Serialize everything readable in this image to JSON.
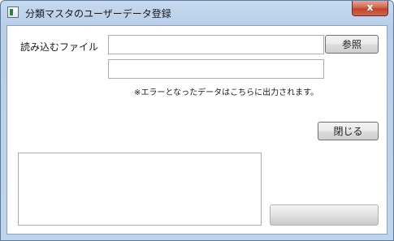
{
  "window": {
    "title": "分類マスタのユーザーデータ登録",
    "close_glyph": "x"
  },
  "form": {
    "file_label": "読み込むファイル",
    "file_path_value": "",
    "browse_label": "参照",
    "error_path_value": "",
    "error_note": "※エラーとなったデータはこちらに出力されます。",
    "close_label": "閉じる",
    "log_text": "",
    "execute_label": ""
  },
  "icons": {
    "app": "app-window-icon",
    "close": "close-icon"
  }
}
